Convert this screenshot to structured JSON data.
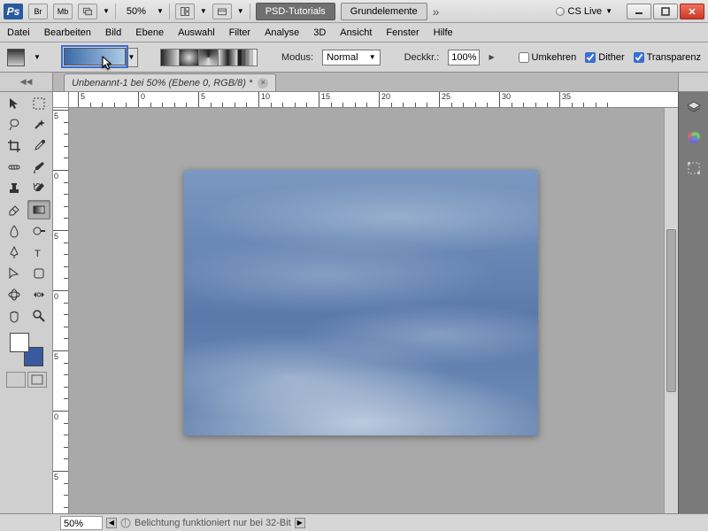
{
  "titlebar": {
    "zoom": "50%",
    "tabs": [
      {
        "label": "PSD-Tutorials",
        "active": true
      },
      {
        "label": "Grundelemente",
        "active": false
      }
    ],
    "cslive": "CS Live"
  },
  "menu": [
    "Datei",
    "Bearbeiten",
    "Bild",
    "Ebene",
    "Auswahl",
    "Filter",
    "Analyse",
    "3D",
    "Ansicht",
    "Fenster",
    "Hilfe"
  ],
  "options": {
    "modus_label": "Modus:",
    "modus_value": "Normal",
    "deckkr_label": "Deckkr.:",
    "deckkr_value": "100%",
    "umkehren": "Umkehren",
    "dither": "Dither",
    "transparenz": "Transparenz",
    "dither_checked": true,
    "transparenz_checked": true,
    "umkehren_checked": false
  },
  "document": {
    "tab_title": "Unbenannt-1 bei 50% (Ebene 0, RGB/8) *"
  },
  "ruler": {
    "h_majors": [
      {
        "pos": 10,
        "label": "5"
      },
      {
        "pos": 78,
        "label": "0"
      },
      {
        "pos": 146,
        "label": "5"
      },
      {
        "pos": 214,
        "label": "10"
      },
      {
        "pos": 282,
        "label": "15"
      },
      {
        "pos": 350,
        "label": "20"
      },
      {
        "pos": 418,
        "label": "25"
      },
      {
        "pos": 486,
        "label": "30"
      },
      {
        "pos": 554,
        "label": "35"
      }
    ],
    "v_majors": [
      {
        "pos": 2,
        "label": "5"
      },
      {
        "pos": 70,
        "label": "0"
      },
      {
        "pos": 138,
        "label": "5"
      },
      {
        "pos": 206,
        "label": "0"
      },
      {
        "pos": 274,
        "label": "5"
      },
      {
        "pos": 342,
        "label": "0"
      },
      {
        "pos": 410,
        "label": "5"
      }
    ]
  },
  "status": {
    "zoom": "50%",
    "message": "Belichtung funktioniert nur bei 32-Bit"
  }
}
